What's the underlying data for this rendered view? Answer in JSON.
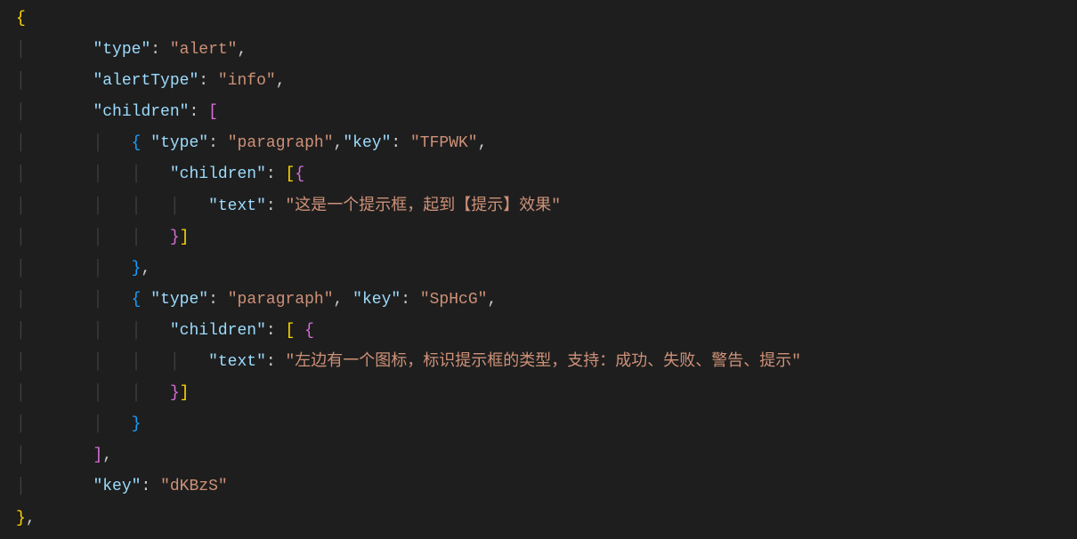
{
  "code": {
    "keys": {
      "type": "\"type\"",
      "alertType": "\"alertType\"",
      "children": "\"children\"",
      "key": "\"key\"",
      "text": "\"text\""
    },
    "strings": {
      "alert": "\"alert\"",
      "info": "\"info\"",
      "paragraph": "\"paragraph\"",
      "tfpwk": "\"TFPWK\"",
      "text1": "\"这是一个提示框，起到【提示】效果\"",
      "sphcg": "\"SpHcG\"",
      "text2": "\"左边有一个图标，标识提示框的类型，支持：成功、失败、警告、提示\"",
      "dkbzs": "\"dKBzS\""
    },
    "tokens": {
      "lbrace": "{",
      "rbrace": "}",
      "lbrack": "[",
      "rbrack": "]",
      "colon": ":",
      "comma": ",",
      "sp": " "
    }
  }
}
